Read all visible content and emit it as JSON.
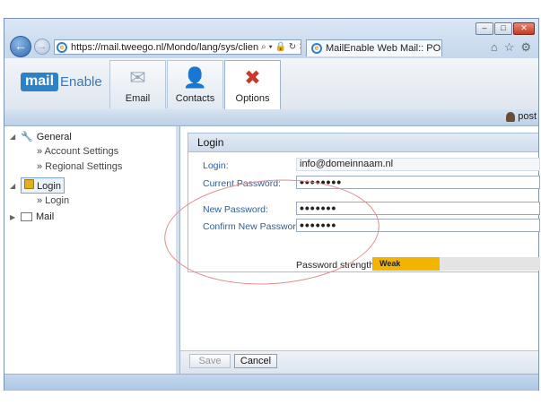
{
  "browser": {
    "address": "https://mail.tweego.nl/Mondo/lang/sys/clien",
    "address_host": "tweego.nl",
    "tab_title": "MailEnable Web Mail:: POS...",
    "window_buttons": [
      "–",
      "□",
      "✕"
    ]
  },
  "app": {
    "logo_left": "mail",
    "logo_right": "Enable",
    "nav": [
      {
        "label": "Email",
        "icon": "envelope-icon"
      },
      {
        "label": "Contacts",
        "icon": "person-icon"
      },
      {
        "label": "Options",
        "icon": "tools-icon"
      }
    ],
    "user": "post"
  },
  "sidebar": {
    "general": "General",
    "account_settings": "» Account Settings",
    "regional_settings": "» Regional Settings",
    "login": "Login",
    "login_sub": "» Login",
    "mail": "Mail"
  },
  "form": {
    "title": "Login",
    "fields": {
      "login_label": "Login:",
      "login_value": "info@domeinnaam.nl",
      "current_label": "Current Password:",
      "current_value": "••••••••",
      "new_label": "New Password:",
      "new_value": "•••••••",
      "confirm_label": "Confirm New Password:",
      "confirm_value": "•••••••"
    },
    "strength_label": "Password strength:",
    "strength_value": "Weak",
    "strength_level": 0.4
  },
  "buttons": {
    "save": "Save",
    "cancel": "Cancel"
  },
  "colors": {
    "accent": "#2c82c9",
    "strength_weak": "#f2b400",
    "annotation": "#e48b8b"
  }
}
